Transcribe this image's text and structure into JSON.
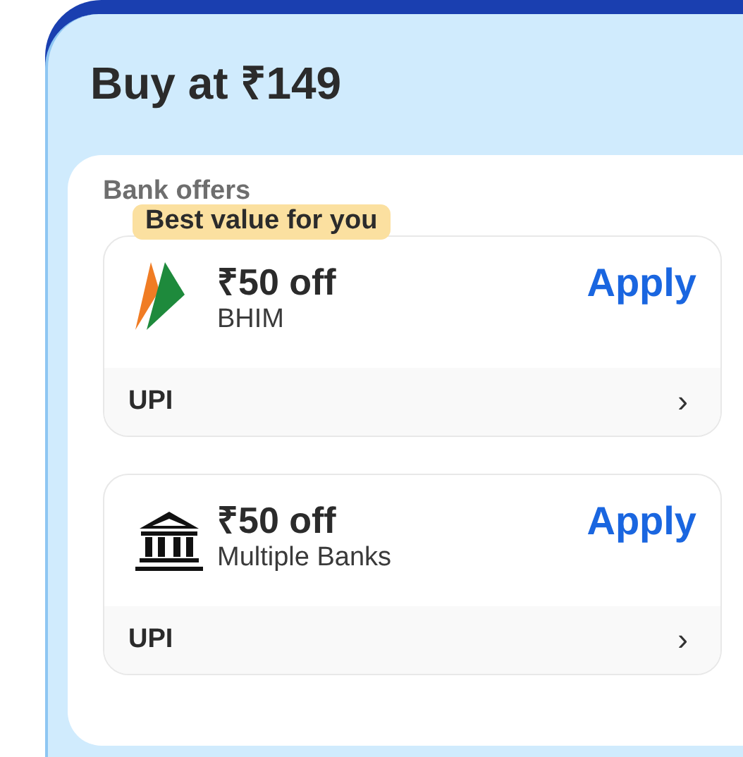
{
  "title": "Buy at ₹149",
  "section": {
    "heading": "Bank offers",
    "offers": [
      {
        "kind": "arrows",
        "badge": "Best value for you",
        "amount": "₹50 off",
        "provider": "BHIM",
        "action": "Apply",
        "method": "UPI",
        "chevron": "›"
      },
      {
        "kind": "bank",
        "amount": "₹50 off",
        "provider": "Multiple Banks",
        "action": "Apply",
        "method": "UPI",
        "chevron": "›"
      }
    ]
  }
}
